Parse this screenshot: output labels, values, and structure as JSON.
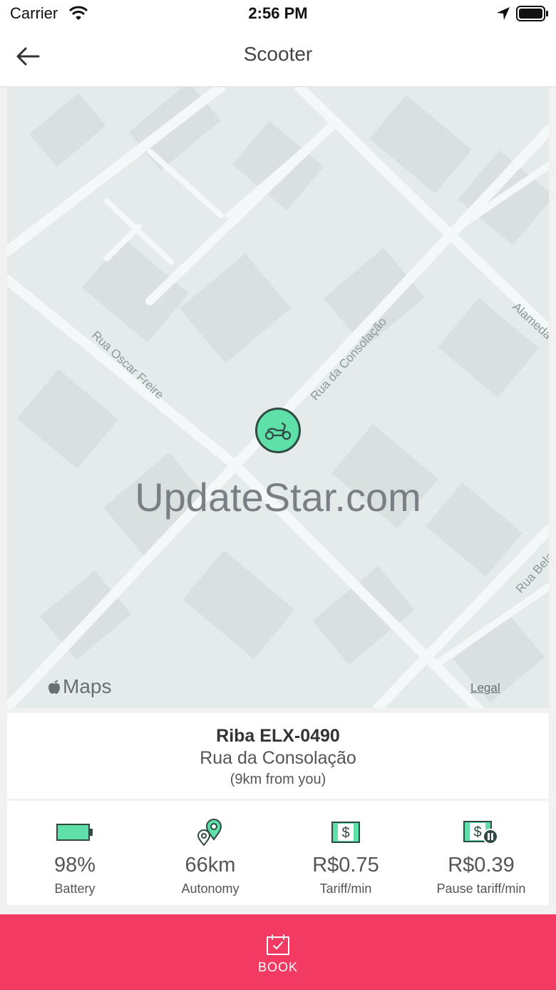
{
  "status_bar": {
    "carrier": "Carrier",
    "time": "2:56 PM"
  },
  "nav": {
    "title": "Scooter",
    "back_icon": "arrow-left-icon"
  },
  "map": {
    "streets": [
      "Rua Oscar Freire",
      "Rua da Consolação",
      "Alameda",
      "Rua Bela"
    ],
    "watermark": "UpdateStar.com",
    "maps_logo": "Maps",
    "legal": "Legal",
    "pin_icon": "scooter-icon",
    "pin_color": "#5ee0a8"
  },
  "vehicle": {
    "name": "Riba ELX-0490",
    "street": "Rua da Consolação",
    "distance": "(9km from you)"
  },
  "stats": [
    {
      "icon": "battery-icon",
      "value": "98%",
      "label": "Battery"
    },
    {
      "icon": "route-pin-icon",
      "value": "66km",
      "label": "Autonomy"
    },
    {
      "icon": "money-icon",
      "value": "R$0.75",
      "label": "Tariff/min"
    },
    {
      "icon": "money-pause-icon",
      "value": "R$0.39",
      "label": "Pause tariff/min"
    }
  ],
  "book": {
    "label": "BOOK",
    "icon": "calendar-check-icon",
    "color": "#f23a63"
  }
}
